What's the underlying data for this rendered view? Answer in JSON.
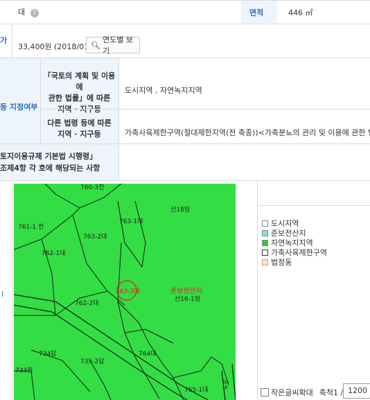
{
  "row1": {
    "value": "대",
    "area_label": "면적",
    "area_value": "446 ㎡"
  },
  "row2": {
    "label_fragment": "가",
    "price": "33,400원 (2018/01)",
    "yearly_button": "연도별 보기"
  },
  "row3": {
    "left_label": "등 지정여부",
    "law1_label_l1": "「국토의 계획 및 이용에",
    "law1_label_l2": "관한 법률」에 따른",
    "law1_label_l3": "지역 · 지구등",
    "law1_value": "도시지역 , 자연녹지지역",
    "law2_label_l1": "다른 법령 등에 따른",
    "law2_label_l2": "지역 · 지구등",
    "law2_value": "가축사육제한구역(절대제한지역(전 축종))<가축분뇨의 관리 및 이용에 관한 법률"
  },
  "row4": {
    "label_l1": "토지이용규제 기본법 시행령」",
    "label_l2": "조제4항 각 호에 해당되는 사항"
  },
  "map": {
    "parcels": [
      "760-3전",
      "산18임",
      "763-1대",
      "761-1 전",
      "763-2대",
      "762-1대",
      "763-3대",
      "준보전산지",
      "산16-1임",
      "762-2대",
      "734답",
      "764대",
      "735-2답",
      "733전",
      "765-1대",
      "도로"
    ],
    "left_marker": "I"
  },
  "legend": {
    "items": [
      {
        "label": "도시지역",
        "color": "#ffffff"
      },
      {
        "label": "준보전산지",
        "color": "#7fe0e0"
      },
      {
        "label": "자연녹지지역",
        "color": "#33cc33"
      },
      {
        "label": "가축사육제한구역",
        "color": "#ffffff"
      },
      {
        "label": "법정동",
        "color": "#f5e6c8"
      }
    ]
  },
  "footer": {
    "small_text_label": "작은글씨확대",
    "scale_label": "축척1 /",
    "scale_value": "1200"
  }
}
